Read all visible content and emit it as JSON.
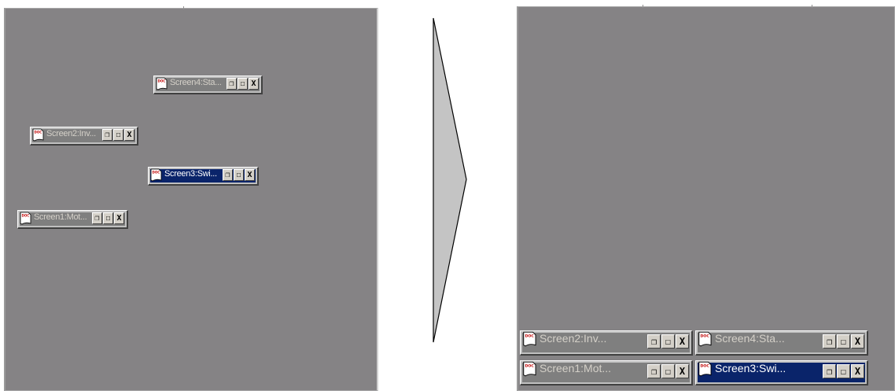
{
  "colors": {
    "desktop": "#858385",
    "inactive_title": "#7f7f7f",
    "active_title": "#0a246a",
    "frame": "#c0c0c0"
  },
  "left_windows": [
    {
      "title": "Screen4:Sta...",
      "active": false
    },
    {
      "title": "Screen2:Inv...",
      "active": false
    },
    {
      "title": "Screen3:Swi...",
      "active": true
    },
    {
      "title": "Screen1:Mot...",
      "active": false
    }
  ],
  "right_windows": [
    {
      "title": "Screen2:Inv...",
      "active": false
    },
    {
      "title": "Screen4:Sta...",
      "active": false
    },
    {
      "title": "Screen1:Mot...",
      "active": false
    },
    {
      "title": "Screen3:Swi...",
      "active": true
    }
  ],
  "buttons": {
    "restore": "🗗",
    "maximize": "☐",
    "close": "X"
  },
  "icons": {
    "document": "doc-icon",
    "arrow": "right-arrow-icon"
  }
}
